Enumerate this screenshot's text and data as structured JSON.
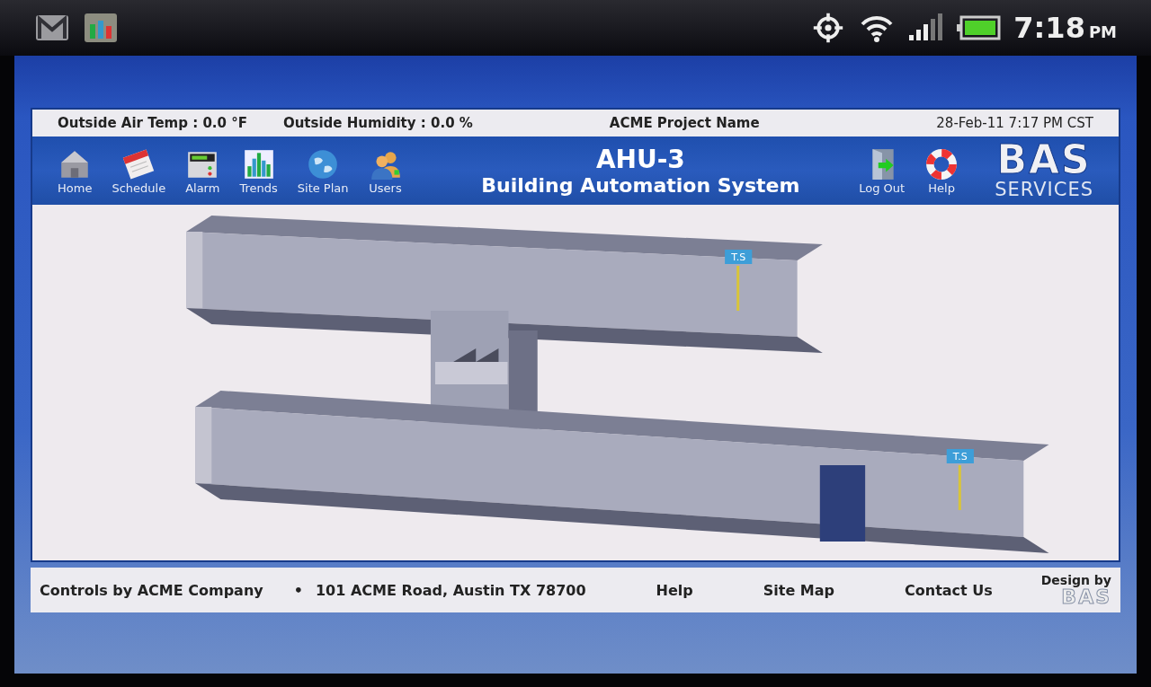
{
  "status_bar": {
    "time": "7:18",
    "ampm": "PM"
  },
  "info_bar": {
    "outside_air_temp": "Outside Air Temp : 0.0 °F",
    "outside_humidity": "Outside Humidity : 0.0 %",
    "project": "ACME Project Name",
    "datetime": "28-Feb-11 7:17 PM CST"
  },
  "nav": [
    {
      "kind": "home",
      "label": "Home"
    },
    {
      "kind": "schedule",
      "label": "Schedule"
    },
    {
      "kind": "alarm",
      "label": "Alarm"
    },
    {
      "kind": "trends",
      "label": "Trends"
    },
    {
      "kind": "siteplan",
      "label": "Site Plan"
    },
    {
      "kind": "users",
      "label": "Users"
    }
  ],
  "title": "AHU-3",
  "subtitle": "Building Automation System",
  "nav_right": [
    {
      "kind": "logout",
      "label": "Log Out"
    },
    {
      "kind": "help",
      "label": "Help"
    }
  ],
  "logo": {
    "mark": "BAS",
    "sub": "SERVICES"
  },
  "diagram": {
    "sensors": [
      "T.S",
      "T.S"
    ]
  },
  "footer": {
    "company": "Controls by ACME Company",
    "bullet": "•",
    "address": "101 ACME Road, Austin TX 78700",
    "links": [
      "Help",
      "Site Map",
      "Contact Us"
    ],
    "design_by": "Design by",
    "design_logo": "BAS"
  }
}
